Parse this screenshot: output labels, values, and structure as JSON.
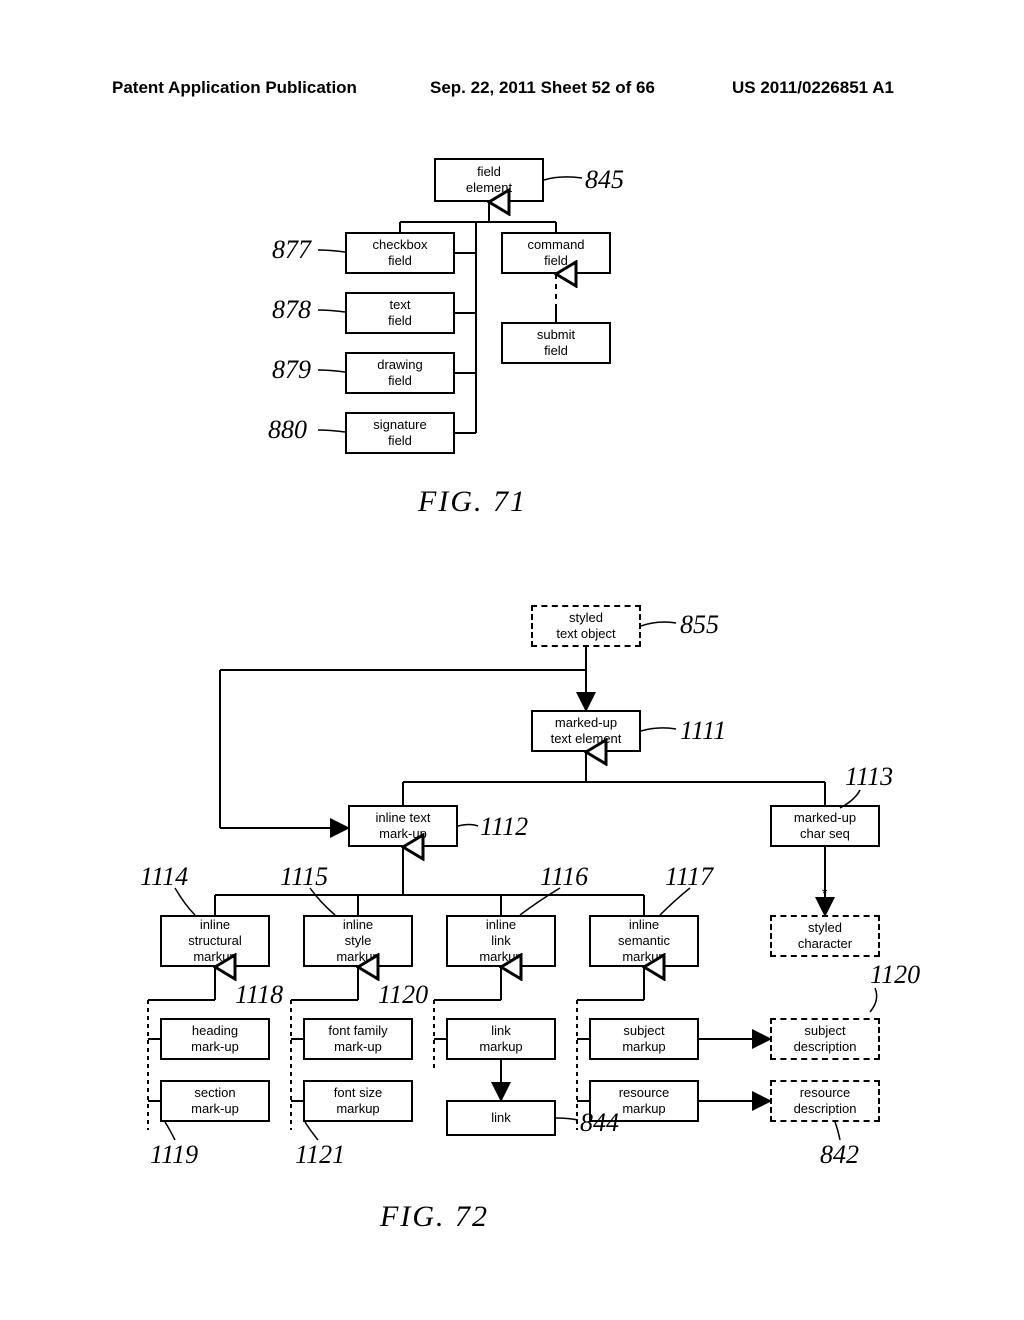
{
  "header": {
    "left": "Patent Application Publication",
    "center": "Sep. 22, 2011  Sheet 52 of 66",
    "right": "US 2011/0226851 A1"
  },
  "fig71": {
    "caption": "FIG. 71",
    "nodes": {
      "field_element": "field\nelement",
      "checkbox_field": "checkbox\nfield",
      "command_field": "command\nfield",
      "text_field": "text\nfield",
      "submit_field": "submit\nfield",
      "drawing_field": "drawing\nfield",
      "signature_field": "signature\nfield"
    },
    "refs": {
      "r845": "845",
      "r877": "877",
      "r878": "878",
      "r879": "879",
      "r880": "880"
    }
  },
  "fig72": {
    "caption": "FIG. 72",
    "nodes": {
      "styled_text_object": "styled\ntext object",
      "markedup_text_element": "marked-up\ntext element",
      "inline_text_markup": "inline text\nmark-up",
      "markedup_char_seq": "marked-up\nchar seq",
      "inline_structural": "inline\nstructural\nmarkup",
      "inline_style": "inline\nstyle\nmarkup",
      "inline_link": "inline\nlink\nmarkup",
      "inline_semantic": "inline\nsemantic\nmarkup",
      "styled_character": "styled\ncharacter",
      "heading_markup": "heading\nmark-up",
      "font_family_markup": "font family\nmark-up",
      "link_markup": "link\nmarkup",
      "subject_markup": "subject\nmarkup",
      "subject_description": "subject\ndescription",
      "section_markup": "section\nmark-up",
      "font_size_markup": "font size\nmarkup",
      "link": "link",
      "resource_markup": "resource\nmarkup",
      "resource_description": "resource\ndescription"
    },
    "refs": {
      "r855": "855",
      "r1111": "1111",
      "r1112": "1112",
      "r1113": "1113",
      "r1114": "1114",
      "r1115": "1115",
      "r1116": "1116",
      "r1117": "1117",
      "r1118": "1118",
      "r1119": "1119",
      "r1120a": "1120",
      "r1120b": "1120",
      "r1121": "1121",
      "r844": "844",
      "r842": "842"
    },
    "star": "*"
  }
}
